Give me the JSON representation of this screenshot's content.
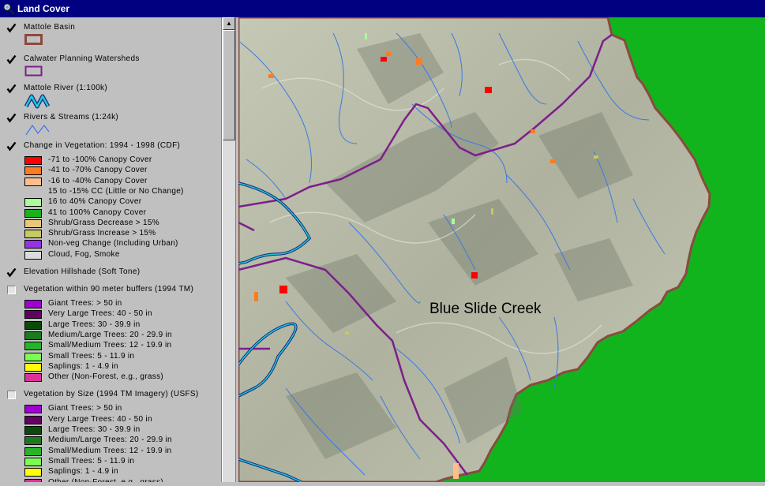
{
  "window": {
    "title": "Land Cover"
  },
  "layers": [
    {
      "name": "Mattole Basin",
      "checked": true,
      "symbol": "basin"
    },
    {
      "name": "Calwater Planning Watersheds",
      "checked": true,
      "symbol": "watershed"
    },
    {
      "name": "Mattole River (1:100k)",
      "checked": true,
      "symbol": "river"
    },
    {
      "name": "Rivers & Streams (1:24k)",
      "checked": true,
      "symbol": "streams"
    },
    {
      "name": "Change in Vegetation: 1994 - 1998 (CDF)",
      "checked": true,
      "symbol": "classes",
      "classes": [
        {
          "label": "-71 to -100% Canopy Cover",
          "color": "#ff0000"
        },
        {
          "label": "-41 to -70% Canopy Cover",
          "color": "#ff7c1e"
        },
        {
          "label": "-16 to -40% Canopy Cover",
          "color": "#ffbe8c"
        },
        {
          "label": "15 to -15% CC (Little or No Change)",
          "color": null
        },
        {
          "label": "16 to 40% Canopy Cover",
          "color": "#aaff96"
        },
        {
          "label": "41 to 100% Canopy Cover",
          "color": "#17b21c"
        },
        {
          "label": "Shrub/Grass Decrease > 15%",
          "color": "#e6c87a"
        },
        {
          "label": "Shrub/Grass Increase > 15%",
          "color": "#c8c864"
        },
        {
          "label": "Non-veg Change (Including Urban)",
          "color": "#9632e6"
        },
        {
          "label": "Cloud, Fog, Smoke",
          "color": "#dcdcdc"
        }
      ]
    },
    {
      "name": "Elevation Hillshade (Soft Tone)",
      "checked": true,
      "symbol": "none"
    },
    {
      "name": "Vegetation within 90 meter buffers (1994 TM)",
      "checked": false,
      "symbol": "classes",
      "classes": [
        {
          "label": "Giant Trees: > 50 in",
          "color": "#a000d2"
        },
        {
          "label": "Very Large Trees: 40 - 50 in",
          "color": "#640064"
        },
        {
          "label": "Large Trees: 30 - 39.9 in",
          "color": "#0a4a0a"
        },
        {
          "label": "Medium/Large Trees: 20 - 29.9 in",
          "color": "#1e781e"
        },
        {
          "label": "Small/Medium Trees: 12 - 19.9 in",
          "color": "#28b428"
        },
        {
          "label": "Small Trees: 5 - 11.9 in",
          "color": "#78ff50"
        },
        {
          "label": "Saplings: 1 - 4.9 in",
          "color": "#ffff00"
        },
        {
          "label": "Other (Non-Forest, e.g., grass)",
          "color": "#dc3296"
        }
      ]
    },
    {
      "name": "Vegetation by Size (1994 TM Imagery) (USFS)",
      "checked": false,
      "symbol": "classes",
      "classes": [
        {
          "label": "Giant Trees: > 50 in",
          "color": "#a000d2"
        },
        {
          "label": "Very Large Trees: 40 - 50 in",
          "color": "#640064"
        },
        {
          "label": "Large Trees: 30 - 39.9 in",
          "color": "#0a4a0a"
        },
        {
          "label": "Medium/Large Trees: 20 - 29.9 in",
          "color": "#1e781e"
        },
        {
          "label": "Small/Medium Trees: 12 - 19.9 in",
          "color": "#28b428"
        },
        {
          "label": "Small Trees: 5 - 11.9 in",
          "color": "#78ff50"
        },
        {
          "label": "Saplings: 1 - 4.9 in",
          "color": "#ffff00"
        },
        {
          "label": "Other (Non-Forest, e.g., grass)",
          "color": "#dc3296"
        }
      ]
    }
  ],
  "map": {
    "label": "Blue Slide Creek",
    "colors": {
      "hillshade": "#b4b8a4",
      "outside": "#12b41e",
      "basin": "#8b4a3e",
      "watershed": "#7d1e8c",
      "river": "#22c8dc",
      "streams": "#3c78e6"
    }
  }
}
